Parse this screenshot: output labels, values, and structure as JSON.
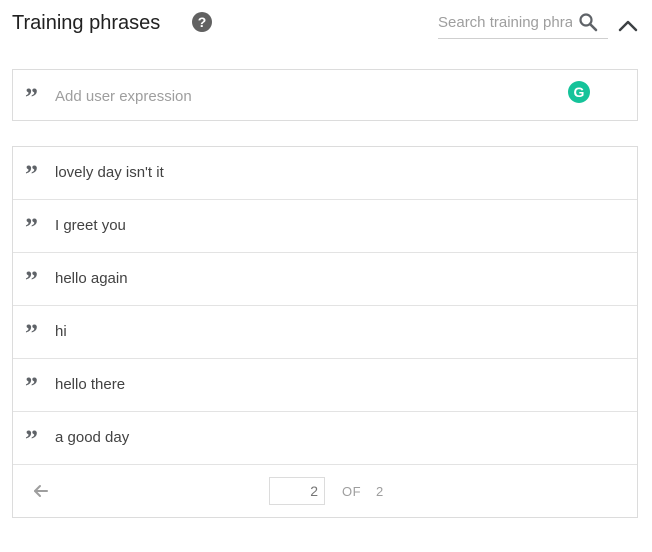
{
  "header": {
    "title": "Training phrases",
    "help_icon": "question-circle-icon",
    "search": {
      "placeholder": "Search training phrases",
      "value": ""
    },
    "collapse_icon": "chevron-up-icon"
  },
  "add_expression": {
    "placeholder": "Add user expression",
    "quote_icon": "quote-icon",
    "grammarly_icon": "grammarly-icon",
    "grammarly_letter": "G"
  },
  "phrases": [
    {
      "text": "lovely day isn't it"
    },
    {
      "text": "I greet you"
    },
    {
      "text": "hello again"
    },
    {
      "text": "hi"
    },
    {
      "text": "hello there"
    },
    {
      "text": "a good day"
    }
  ],
  "pagination": {
    "current_page": "2",
    "of_label": "OF",
    "total_pages": "2",
    "prev_icon": "arrow-left-icon"
  },
  "colors": {
    "border": "#dcdcdc",
    "icon": "#5f6368",
    "grammarly": "#15c39a",
    "placeholder": "#9e9e9e"
  }
}
